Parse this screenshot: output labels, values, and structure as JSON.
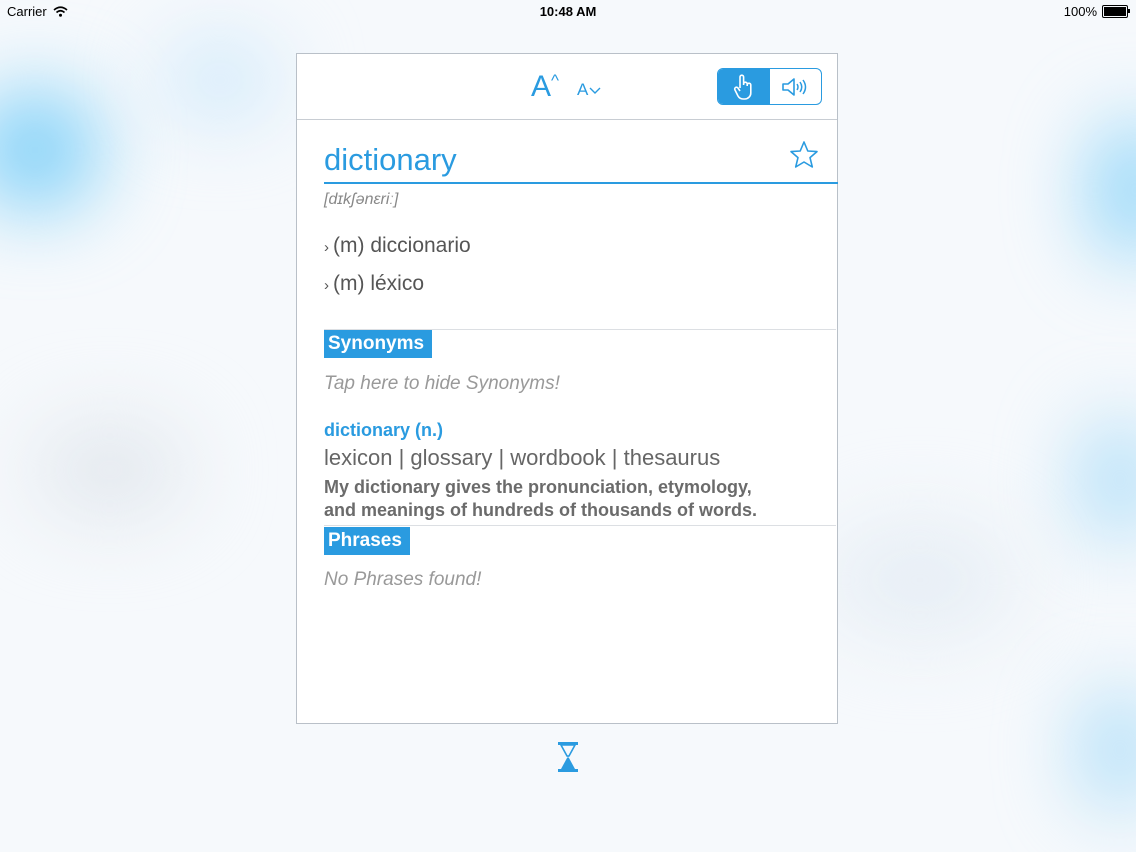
{
  "status_bar": {
    "carrier": "Carrier",
    "time": "10:48 AM",
    "battery": "100%",
    "battery_level": 1.0
  },
  "toolbar": {
    "font_larger": "A",
    "font_smaller": "A",
    "mode_touch_icon": "hand-pointer-icon",
    "mode_sound_icon": "speaker-icon",
    "active_mode": "touch"
  },
  "entry": {
    "word": "dictionary",
    "pronunciation": "[dɪkʃənɛriː]",
    "translations": [
      {
        "chevron": "›",
        "text": "(m) diccionario"
      },
      {
        "chevron": "›",
        "text": "(m) léxico"
      }
    ]
  },
  "synonyms": {
    "label": "Synonyms",
    "hint": "Tap here to hide Synonyms!",
    "head": "dictionary (n.)",
    "words": "lexicon | glossary | wordbook | thesaurus",
    "example_line1": "My dictionary gives the pronunciation, etymology,",
    "example_line2": "and meanings of hundreds of thousands of words."
  },
  "phrases": {
    "label": "Phrases",
    "hint": "No Phrases found!"
  },
  "colors": {
    "accent": "#2a9be0",
    "text": "#555555",
    "muted": "#999999"
  },
  "icons": {
    "star": "star-icon",
    "loading": "hourglass-icon",
    "wifi": "wifi-icon"
  }
}
